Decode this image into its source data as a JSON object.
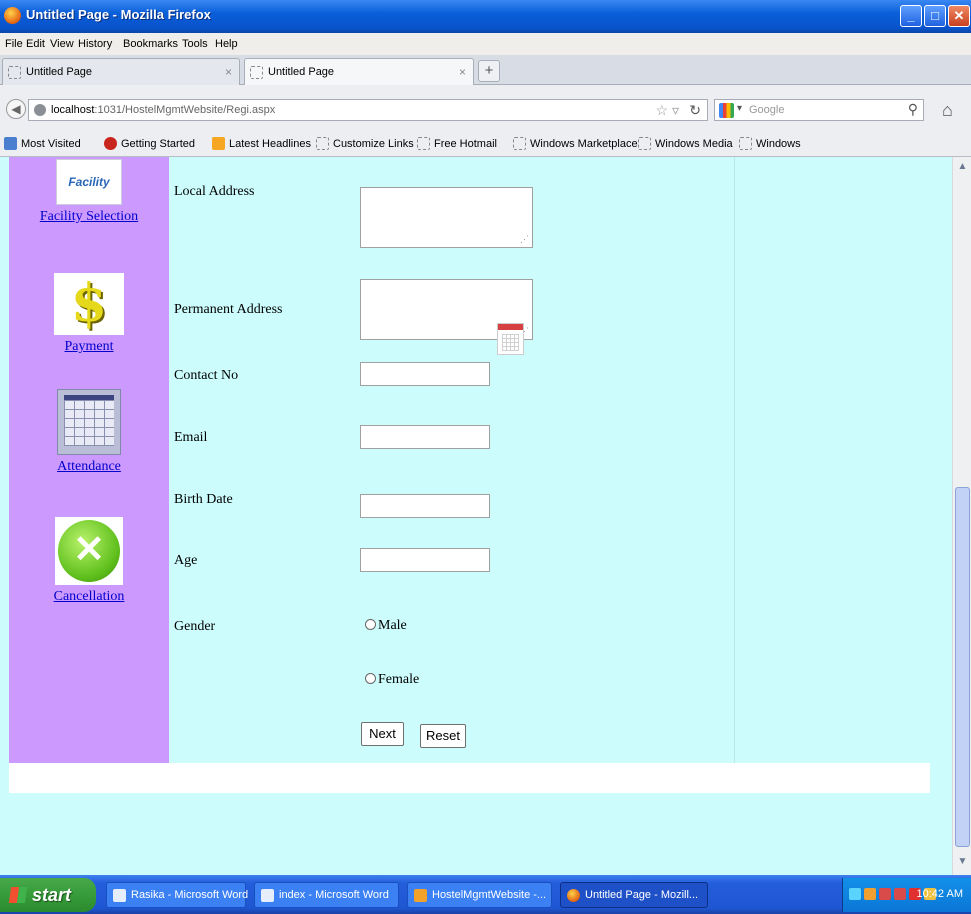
{
  "window": {
    "title": "Untitled Page - Mozilla Firefox",
    "controls": {
      "minimize": "_",
      "maximize": "□",
      "close": "✕"
    }
  },
  "menu": [
    "File",
    "Edit",
    "View",
    "History",
    "Bookmarks",
    "Tools",
    "Help"
  ],
  "tabs": [
    {
      "label": "Untitled Page",
      "close": "×",
      "active": false
    },
    {
      "label": "Untitled Page",
      "close": "×",
      "active": true
    }
  ],
  "new_tab_label": "+",
  "nav": {
    "url_host": "localhost",
    "url_rest": ":1031/HostelMgmtWebsite/Regi.aspx",
    "search_placeholder": "Google"
  },
  "bookmarks": [
    "Most Visited",
    "Getting Started",
    "Latest Headlines",
    "Customize Links",
    "Free Hotmail",
    "Windows Marketplace",
    "Windows Media",
    "Windows"
  ],
  "sidebar": {
    "items": [
      {
        "label": "Facility Selection",
        "icon": "facility-icon",
        "icon_text": "Facility"
      },
      {
        "label": "Payment",
        "icon": "dollar-icon",
        "icon_text": "$"
      },
      {
        "label": "Attendance",
        "icon": "calendar-icon"
      },
      {
        "label": "Cancellation",
        "icon": "cancel-x-icon",
        "icon_text": "✕"
      }
    ]
  },
  "form": {
    "local_address_label": "Local Address",
    "permanent_address_label": "Permanent Address",
    "contact_label": "Contact No",
    "email_label": "Email",
    "birth_date_label": "Birth Date",
    "age_label": "Age",
    "gender_label": "Gender",
    "gender_options": [
      "Male",
      "Female"
    ],
    "next_button": "Next",
    "reset_button": "Reset"
  },
  "taskbar": {
    "start": "start",
    "tasks": [
      {
        "label": "Rasika - Microsoft Word",
        "icon": "word-icon"
      },
      {
        "label": "index - Microsoft Word",
        "icon": "word-icon"
      },
      {
        "label": "HostelMgmtWebsite -...",
        "icon": "visual-studio-icon"
      },
      {
        "label": "Untitled Page - Mozill...",
        "icon": "firefox-icon"
      }
    ],
    "clock": "10:42 AM"
  },
  "colors": {
    "sidebar_bg": "#cc99ff",
    "content_bg": "#ccfcfc",
    "link": "#0000cc",
    "titlebar": "#0a5fd8",
    "taskbar": "#245edb",
    "start_green": "#379c3a"
  }
}
